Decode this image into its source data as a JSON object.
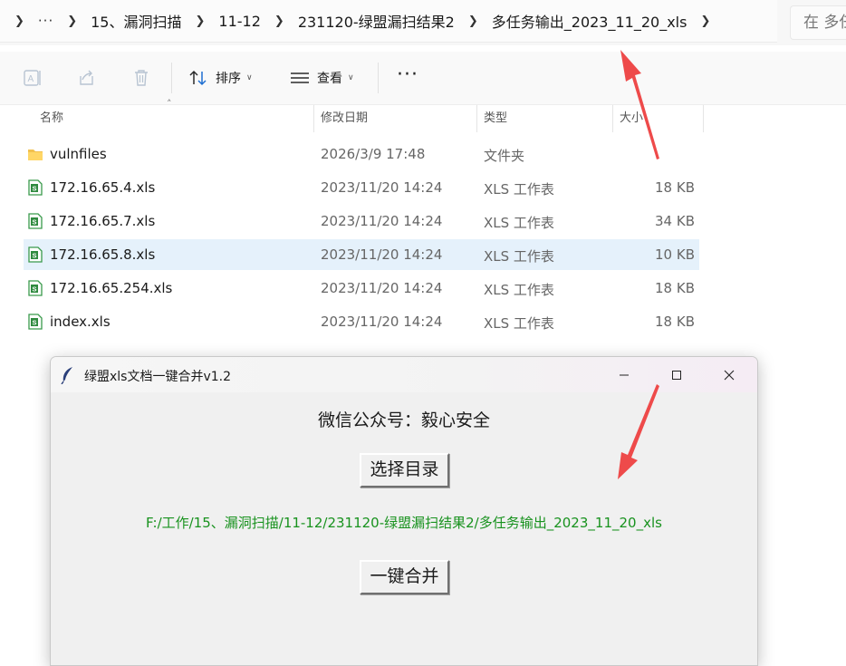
{
  "breadcrumb": {
    "items": [
      "15、漏洞扫描",
      "11-12",
      "231120-绿盟漏扫结果2",
      "多任务输出_2023_11_20_xls"
    ],
    "more": "···"
  },
  "search": {
    "text": "在 多任"
  },
  "toolbar": {
    "sort_label": "排序",
    "view_label": "查看",
    "more": "···"
  },
  "columns": {
    "name": "名称",
    "date": "修改日期",
    "type": "类型",
    "size": "大小"
  },
  "files": [
    {
      "name": "vulnfiles",
      "date": "2026/3/9 17:48",
      "type": "文件夹",
      "size": "",
      "icon": "folder-icon"
    },
    {
      "name": "172.16.65.4.xls",
      "date": "2023/11/20 14:24",
      "type": "XLS 工作表",
      "size": "18 KB",
      "icon": "xls-file-icon"
    },
    {
      "name": "172.16.65.7.xls",
      "date": "2023/11/20 14:24",
      "type": "XLS 工作表",
      "size": "34 KB",
      "icon": "xls-file-icon"
    },
    {
      "name": "172.16.65.8.xls",
      "date": "2023/11/20 14:24",
      "type": "XLS 工作表",
      "size": "10 KB",
      "icon": "xls-file-icon",
      "selected": true
    },
    {
      "name": "172.16.65.254.xls",
      "date": "2023/11/20 14:24",
      "type": "XLS 工作表",
      "size": "18 KB",
      "icon": "xls-file-icon"
    },
    {
      "name": "index.xls",
      "date": "2023/11/20 14:24",
      "type": "XLS 工作表",
      "size": "18 KB",
      "icon": "xls-file-icon"
    }
  ],
  "dialog": {
    "title": "绿盟xls文档一键合并v1.2",
    "heading": "微信公众号：毅心安全",
    "select_button": "选择目录",
    "path": "F:/工作/15、漏洞扫描/11-12/231120-绿盟漏扫结果2/多任务输出_2023_11_20_xls",
    "merge_button": "一键合并"
  },
  "colors": {
    "path_text": "#18921e",
    "selected_row": "#e5f1fb",
    "annotation_arrow": "#ee4a4a"
  }
}
